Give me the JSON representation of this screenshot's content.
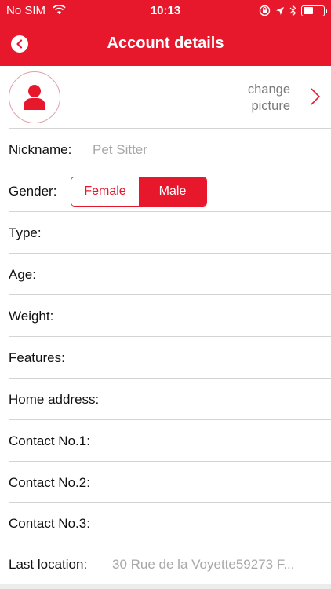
{
  "status_bar": {
    "carrier": "No SIM",
    "time": "10:13",
    "battery_level": 0.55
  },
  "nav": {
    "title": "Account details"
  },
  "profile": {
    "change_picture": "change\npicture"
  },
  "fields": {
    "nickname": {
      "label": "Nickname:",
      "value": "Pet Sitter"
    },
    "gender": {
      "label": "Gender:",
      "options": [
        "Female",
        "Male"
      ],
      "selected": "Male"
    },
    "type": {
      "label": "Type:"
    },
    "age": {
      "label": "Age:"
    },
    "weight": {
      "label": "Weight:"
    },
    "features": {
      "label": "Features:"
    },
    "home_address": {
      "label": "Home address:"
    },
    "contact1": {
      "label": "Contact No.1:"
    },
    "contact2": {
      "label": "Contact No.2:"
    },
    "contact3": {
      "label": "Contact No.3:"
    },
    "last_location": {
      "label": "Last location:",
      "value": "30 Rue de la Voyette59273 F..."
    }
  },
  "colors": {
    "accent": "#e8182c"
  }
}
